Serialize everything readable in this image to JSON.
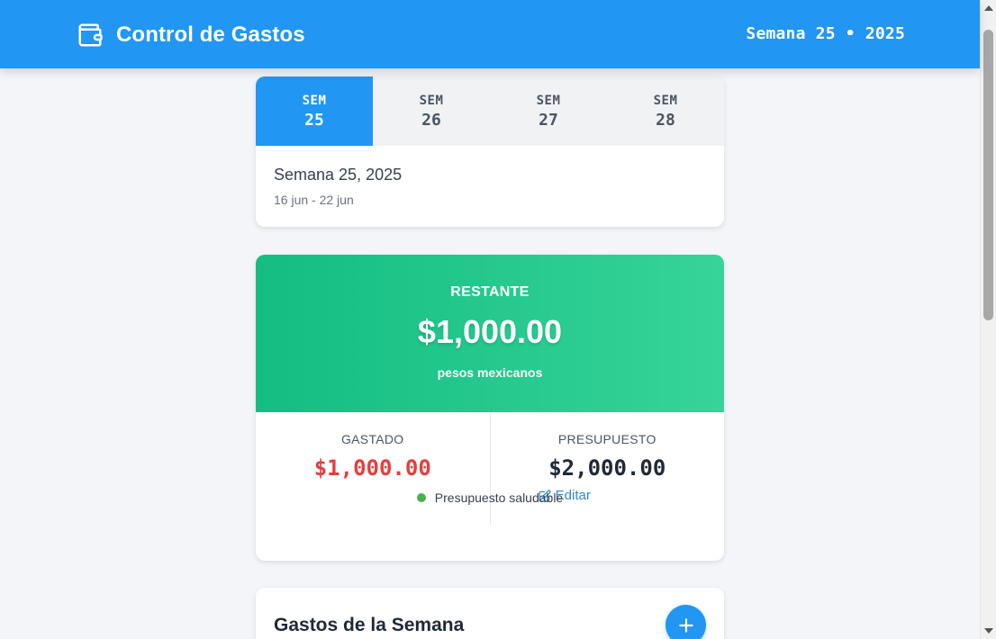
{
  "header": {
    "title": "Control de Gastos",
    "week_label": "Semana 25 • 2025"
  },
  "tabs": [
    {
      "top": "SEM",
      "num": "25",
      "active": true
    },
    {
      "top": "SEM",
      "num": "26",
      "active": false
    },
    {
      "top": "SEM",
      "num": "27",
      "active": false
    },
    {
      "top": "SEM",
      "num": "28",
      "active": false
    }
  ],
  "week_info": {
    "title": "Semana 25, 2025",
    "range": "16 jun - 22 jun"
  },
  "budget": {
    "remaining_label": "RESTANTE",
    "remaining_amount": "$1,000.00",
    "currency_note": "pesos mexicanos",
    "spent_label": "GASTADO",
    "spent_amount": "$1,000.00",
    "budget_label": "PRESUPUESTO",
    "budget_amount": "$2,000.00",
    "edit_label": "Editar",
    "status_text": "Presupuesto saludable"
  },
  "expenses": {
    "title": "Gastos de la Semana"
  },
  "colors": {
    "primary": "#2196f3",
    "success_start": "#14bd82",
    "success_end": "#36d498",
    "danger": "#e53e3e",
    "status_dot": "#4caf50"
  },
  "icons": {
    "brand": "wallet-icon",
    "edit": "edit-icon",
    "add": "plus-icon"
  }
}
